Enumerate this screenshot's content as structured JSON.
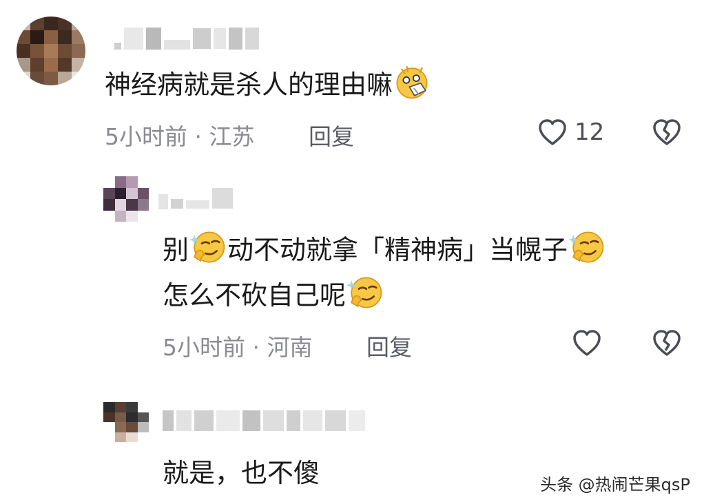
{
  "comments": [
    {
      "text_before": "神经病就是杀人的理由嘛",
      "emoji": "dizzy-face-emoji",
      "time_location": "5小时前 · 江苏",
      "reply_label": "回复",
      "like_count": "12"
    },
    {
      "line1_a": "别",
      "line1_b": "动不动就拿「精神病」当幌子",
      "line2": "怎么不砍自己呢",
      "emoji": "smirk-emoji",
      "time_location": "5小时前 · 河南",
      "reply_label": "回复"
    },
    {
      "text": "就是，也不傻"
    }
  ],
  "watermark": "头条 @热闹芒果qsP",
  "colors": {
    "text": "#1a1a1a",
    "meta": "#8a8b91",
    "icon": "#4b4d55"
  }
}
